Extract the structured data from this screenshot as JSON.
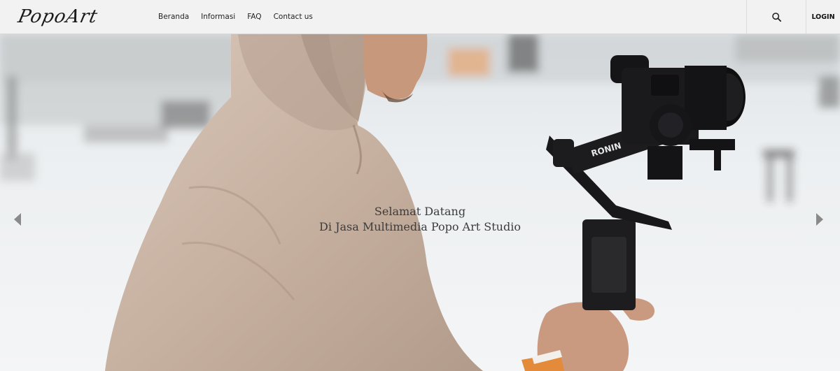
{
  "brand": {
    "logo_text": "PopoArt"
  },
  "nav": {
    "items": [
      "Beranda",
      "Informasi",
      "FAQ",
      "Contact us"
    ]
  },
  "header": {
    "login_label": "LOGIN",
    "search_icon": "search-icon"
  },
  "hero": {
    "line1": "Selamat Datang",
    "line2": "Di Jasa Multimedia Popo Art Studio",
    "gimbal_brand": "RONIN",
    "prev_icon": "chevron-left-icon",
    "next_icon": "chevron-right-icon"
  },
  "colors": {
    "header_bg": "#f2f2f2",
    "hoodie": "#c9b3a3",
    "camera": "#1b1b1d",
    "snow": "#eef1f3"
  }
}
